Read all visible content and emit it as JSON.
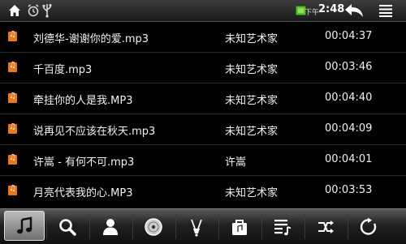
{
  "status_bar": {
    "ampm": "下午",
    "time": "2:48",
    "icons": [
      "home-icon",
      "alarm-icon",
      "usb-icon",
      "battery-icon",
      "back-icon",
      "menu-icon"
    ]
  },
  "songs": [
    {
      "title": "刘德华-谢谢你的爱.mp3",
      "artist": "未知艺术家",
      "duration": "00:04:37"
    },
    {
      "title": "千百度.mp3",
      "artist": "未知艺术家",
      "duration": "00:03:46"
    },
    {
      "title": "牵挂你的人是我.MP3",
      "artist": "未知艺术家",
      "duration": "00:04:40"
    },
    {
      "title": "说再见不应该在秋天.mp3",
      "artist": "未知艺术家",
      "duration": "00:04:09"
    },
    {
      "title": "许嵩 - 有何不可.mp3",
      "artist": "许嵩",
      "duration": "00:04:01"
    },
    {
      "title": "月亮代表我的心.MP3",
      "artist": "未知艺术家",
      "duration": "00:03:53"
    }
  ],
  "toolbar": {
    "buttons": [
      "music-note-icon",
      "search-icon",
      "artist-icon",
      "album-icon",
      "genre-icon",
      "folder-icon",
      "playlist-icon",
      "shuffle-icon",
      "repeat-icon"
    ],
    "active": "music-note-icon"
  },
  "colors": {
    "file_icon": "#e8781e",
    "background": "#000000",
    "text": "#f2f2f2"
  }
}
